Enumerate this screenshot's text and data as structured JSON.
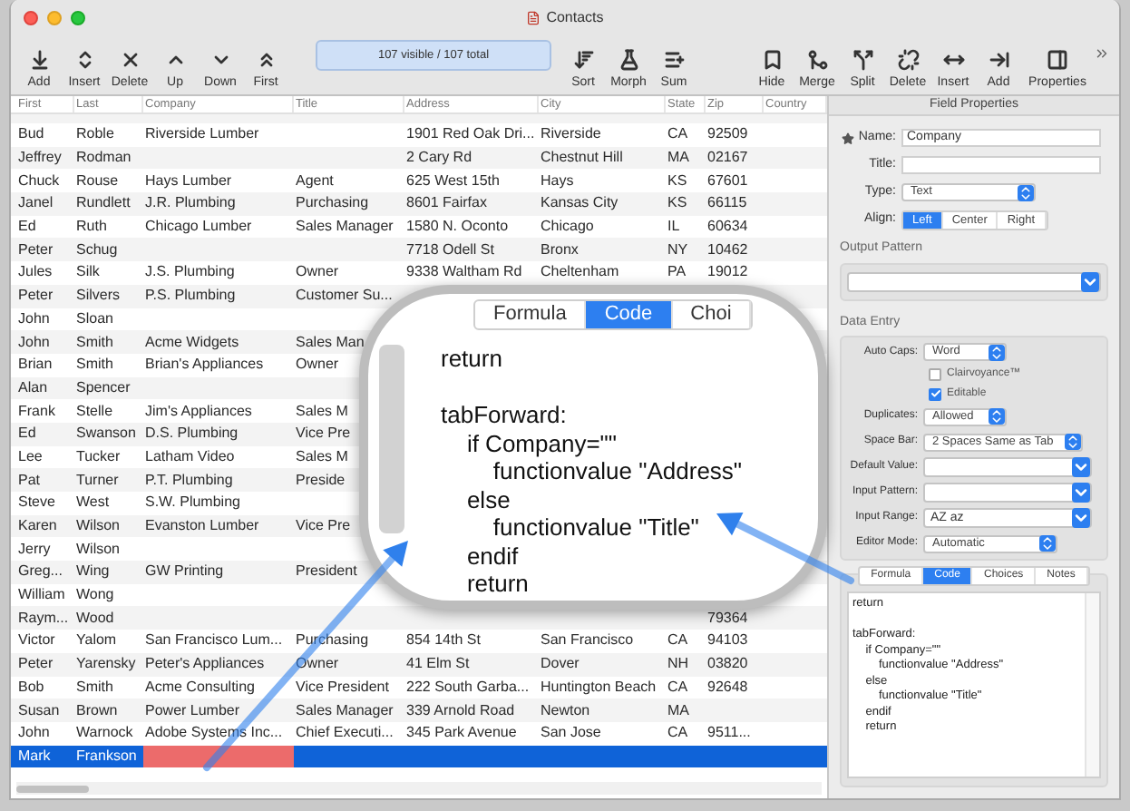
{
  "window": {
    "title": "Contacts"
  },
  "toolbar": {
    "left_buttons": [
      "Add",
      "Insert",
      "Delete",
      "Up",
      "Down",
      "First"
    ],
    "status": "107 visible / 107 total",
    "middle_buttons": [
      "Sort",
      "Morph",
      "Sum"
    ],
    "right_buttons": [
      "Hide",
      "Merge",
      "Split",
      "Delete",
      "Insert",
      "Add",
      "Properties"
    ]
  },
  "table": {
    "columns": [
      "First",
      "Last",
      "Company",
      "Title",
      "Address",
      "City",
      "State",
      "Zip",
      "Country"
    ],
    "rows": [
      {
        "cells": [
          "Bud",
          "Roble",
          "Riverside Lumber",
          null,
          "1901 Red Oak Dri...",
          "Riverside",
          "CA",
          "92509"
        ],
        "selected": false,
        "company_flagged": false
      },
      {
        "cells": [
          "Jeffrey",
          "Rodman",
          null,
          null,
          "2 Cary Rd",
          "Chestnut Hill",
          "MA",
          "02167"
        ],
        "selected": false,
        "company_flagged": false
      },
      {
        "cells": [
          "Chuck",
          "Rouse",
          "Hays Lumber",
          "Agent",
          "625 West 15th",
          "Hays",
          "KS",
          "67601"
        ],
        "selected": false,
        "company_flagged": false
      },
      {
        "cells": [
          "Janel",
          "Rundlett",
          "J.R. Plumbing",
          "Purchasing",
          "8601 Fairfax",
          "Kansas City",
          "KS",
          "66115"
        ],
        "selected": false,
        "company_flagged": false
      },
      {
        "cells": [
          "Ed",
          "Ruth",
          "Chicago Lumber",
          "Sales Manager",
          "1580 N. Oconto",
          "Chicago",
          "IL",
          "60634"
        ],
        "selected": false,
        "company_flagged": false
      },
      {
        "cells": [
          "Peter",
          "Schug",
          null,
          null,
          "7718 Odell St",
          "Bronx",
          "NY",
          "10462"
        ],
        "selected": false,
        "company_flagged": false
      },
      {
        "cells": [
          "Jules",
          "Silk",
          "J.S. Plumbing",
          "Owner",
          "9338 Waltham Rd",
          "Cheltenham",
          "PA",
          "19012"
        ],
        "selected": false,
        "company_flagged": false
      },
      {
        "cells": [
          "Peter",
          "Silvers",
          "P.S. Plumbing",
          "Customer Su..."
        ],
        "selected": false,
        "company_flagged": false
      },
      {
        "cells": [
          "John",
          "Sloan"
        ],
        "selected": false,
        "company_flagged": false
      },
      {
        "cells": [
          "John",
          "Smith",
          "Acme Widgets",
          "Sales Man"
        ],
        "selected": false,
        "company_flagged": false
      },
      {
        "cells": [
          "Brian",
          "Smith",
          "Brian's Appliances",
          "Owner"
        ],
        "selected": false,
        "company_flagged": false
      },
      {
        "cells": [
          "Alan",
          "Spencer"
        ],
        "selected": false,
        "company_flagged": false
      },
      {
        "cells": [
          "Frank",
          "Stelle",
          "Jim's Appliances",
          "Sales M"
        ],
        "selected": false,
        "company_flagged": false
      },
      {
        "cells": [
          "Ed",
          "Swanson",
          "D.S. Plumbing",
          "Vice Pre"
        ],
        "selected": false,
        "company_flagged": false
      },
      {
        "cells": [
          "Lee",
          "Tucker",
          "Latham Video",
          "Sales M"
        ],
        "selected": false,
        "company_flagged": false
      },
      {
        "cells": [
          "Pat",
          "Turner",
          "P.T. Plumbing",
          "Preside"
        ],
        "selected": false,
        "company_flagged": false
      },
      {
        "cells": [
          "Steve",
          "West",
          "S.W. Plumbing"
        ],
        "selected": false,
        "company_flagged": false
      },
      {
        "cells": [
          "Karen",
          "Wilson",
          "Evanston Lumber",
          "Vice Pre"
        ],
        "selected": false,
        "company_flagged": false
      },
      {
        "cells": [
          "Jerry",
          "Wilson"
        ],
        "selected": false,
        "company_flagged": false
      },
      {
        "cells": [
          "Greg...",
          "Wing",
          "GW Printing",
          "President"
        ],
        "selected": false,
        "company_flagged": false
      },
      {
        "cells": [
          "William",
          "Wong"
        ],
        "selected": false,
        "company_flagged": false
      },
      {
        "cells": [
          "Raym...",
          "Wood",
          null,
          null,
          null,
          null,
          null,
          "79364"
        ],
        "selected": false,
        "company_flagged": false
      },
      {
        "cells": [
          "Victor",
          "Yalom",
          "San Francisco Lum...",
          "Purchasing",
          "854 14th St",
          "San Francisco",
          "CA",
          "94103"
        ],
        "selected": false,
        "company_flagged": false
      },
      {
        "cells": [
          "Peter",
          "Yarensky",
          "Peter's Appliances",
          "Owner",
          "41 Elm St",
          "Dover",
          "NH",
          "03820"
        ],
        "selected": false,
        "company_flagged": false
      },
      {
        "cells": [
          "Bob",
          "Smith",
          "Acme Consulting",
          "Vice President",
          "222 South Garba...",
          "Huntington Beach",
          "CA",
          "92648"
        ],
        "selected": false,
        "company_flagged": false
      },
      {
        "cells": [
          "Susan",
          "Brown",
          "Power Lumber",
          "Sales Manager",
          "339 Arnold Road",
          "Newton",
          "MA"
        ],
        "selected": false,
        "company_flagged": false
      },
      {
        "cells": [
          "John",
          "Warnock",
          "Adobe Systems Inc...",
          "Chief Executi...",
          "345 Park Avenue",
          "San Jose",
          "CA",
          "9511..."
        ],
        "selected": false,
        "company_flagged": false
      },
      {
        "cells": [
          "Mark",
          "Frankson"
        ],
        "selected": true,
        "company_flagged": true
      }
    ]
  },
  "magnifier": {
    "tabs": [
      {
        "label": "Formula",
        "selected": false
      },
      {
        "label": "Code",
        "selected": true
      },
      {
        "label": "Choi",
        "selected": false
      }
    ],
    "code": "return\n\ntabForward:\n    if Company=\"\"\n        functionvalue \"Address\"\n    else\n        functionvalue \"Title\"\n    endif\n    return"
  },
  "panel": {
    "title": "Field Properties",
    "name_label": "Name:",
    "name_value": "Company",
    "title_label": "Title:",
    "type_label": "Type:",
    "type_value": "Text",
    "align_label": "Align:",
    "align_options": [
      {
        "label": "Left",
        "selected": true
      },
      {
        "label": "Center",
        "selected": false
      },
      {
        "label": "Right",
        "selected": false
      }
    ],
    "output_pattern_label": "Output Pattern",
    "data_entry_label": "Data Entry",
    "auto_caps": {
      "label": "Auto Caps:",
      "value": "Word"
    },
    "checkboxes": [
      {
        "label": "Clairvoyance™",
        "checked": false
      },
      {
        "label": "Editable",
        "checked": true
      }
    ],
    "fields": [
      {
        "label": "Duplicates:",
        "value": "Allowed",
        "kind": "popup"
      },
      {
        "label": "Space Bar:",
        "value": "2 Spaces Same as Tab",
        "kind": "popup"
      },
      {
        "label": "Default Value:",
        "kind": "combo"
      },
      {
        "label": "Input Pattern:",
        "kind": "combo"
      },
      {
        "label": "Input Range:",
        "value": "AZ  az",
        "kind": "combo"
      },
      {
        "label": "Editor Mode:",
        "value": "Automatic",
        "kind": "popup"
      }
    ],
    "tabs": [
      {
        "label": "Formula",
        "selected": false
      },
      {
        "label": "Code",
        "selected": true
      },
      {
        "label": "Choices",
        "selected": false
      },
      {
        "label": "Notes",
        "selected": false
      }
    ],
    "code": "return\n\ntabForward:\n    if Company=\"\"\n        functionvalue \"Address\"\n    else\n        functionvalue \"Title\"\n    endif\n    return"
  }
}
